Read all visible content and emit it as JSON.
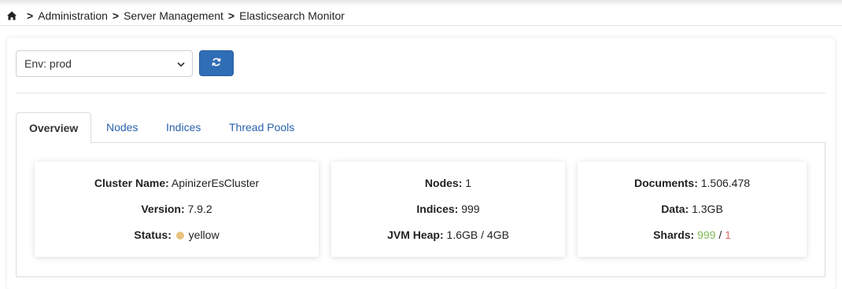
{
  "breadcrumb": {
    "home_icon": "home-icon",
    "separator": ">",
    "items": [
      "Administration",
      "Server Management",
      "Elasticsearch Monitor"
    ]
  },
  "toolbar": {
    "env_select": {
      "selected": "Env: prod"
    },
    "refresh_icon": "refresh-icon"
  },
  "tabs": [
    {
      "label": "Overview",
      "active": true
    },
    {
      "label": "Nodes"
    },
    {
      "label": "Indices"
    },
    {
      "label": "Thread Pools"
    }
  ],
  "cards": {
    "cluster": {
      "name_label": "Cluster Name:",
      "name_value": "ApinizerEsCluster",
      "version_label": "Version:",
      "version_value": "7.9.2",
      "status_label": "Status:",
      "status_value": "yellow"
    },
    "nodes": {
      "nodes_label": "Nodes:",
      "nodes_value": "1",
      "indices_label": "Indices:",
      "indices_value": "999",
      "jvm_label": "JVM Heap:",
      "jvm_value": "1.6GB / 4GB"
    },
    "docs": {
      "documents_label": "Documents:",
      "documents_value": "1.506.478",
      "data_label": "Data:",
      "data_value": "1.3GB",
      "shards_label": "Shards:",
      "shards_active": "999",
      "shards_sep": "/",
      "shards_unassigned": "1"
    }
  },
  "colors": {
    "accent": "#2f6db5",
    "link": "#2a62ad",
    "status_yellow": "#e8c37e",
    "shards_green": "#7dbb55",
    "shards_red": "#dd6b66"
  }
}
